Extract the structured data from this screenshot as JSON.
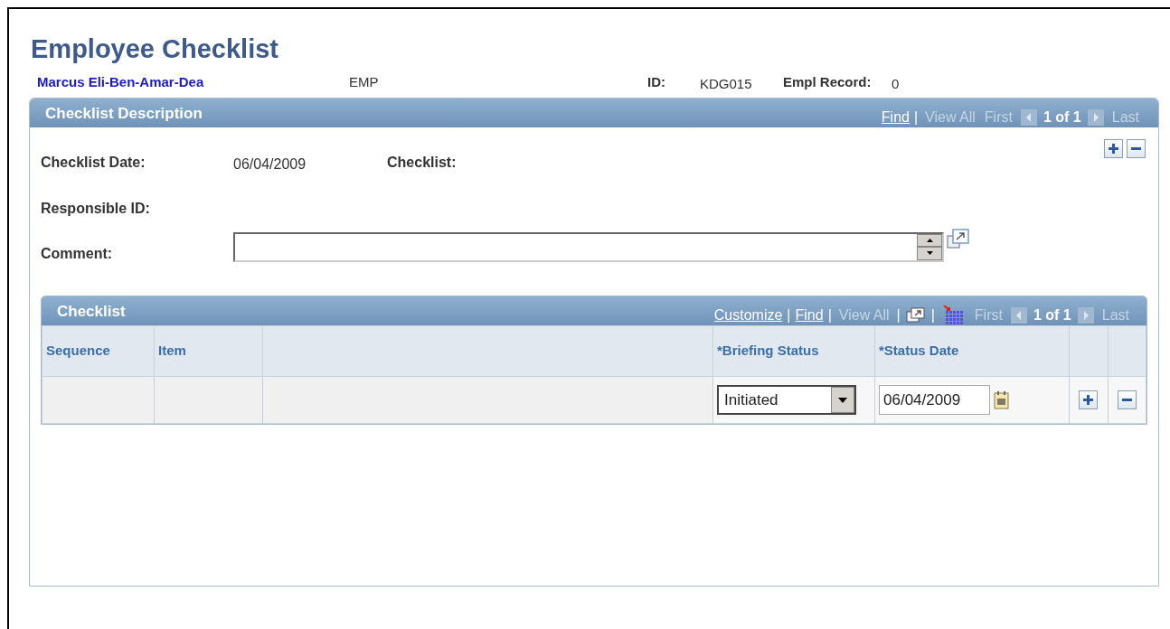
{
  "page_title": "Employee Checklist",
  "employee": {
    "name": "Marcus Eli-Ben-Amar-Dea",
    "type": "EMP",
    "id_label": "ID:",
    "id": "KDG015",
    "record_label": "Empl Record:",
    "record": "0"
  },
  "description_section": {
    "title": "Checklist Description",
    "nav": [
      {
        "kind": "link",
        "text": "Find"
      },
      {
        "kind": "separator",
        "text": "|"
      },
      {
        "kind": "disabled",
        "text": "View All"
      },
      {
        "kind": "disabled",
        "text": "First"
      },
      {
        "kind": "prev"
      },
      {
        "kind": "counter",
        "text": "1 of 1"
      },
      {
        "kind": "next"
      },
      {
        "kind": "disabled",
        "text": "Last"
      }
    ],
    "fields": [
      {
        "label": "Checklist Date:",
        "value": "06/04/2009"
      },
      {
        "label": "Checklist:"
      },
      {
        "label": "Responsible ID:"
      },
      {
        "label": "Comment:",
        "kind": "textarea"
      }
    ]
  },
  "checklist_grid": {
    "title": "Checklist",
    "nav": [
      {
        "kind": "link",
        "text": "Customize"
      },
      {
        "kind": "separator",
        "text": "|"
      },
      {
        "kind": "link",
        "text": "Find"
      },
      {
        "kind": "separator",
        "text": "|"
      },
      {
        "kind": "disabled",
        "text": "View All"
      },
      {
        "kind": "separator",
        "text": "|"
      },
      {
        "kind": "popup"
      },
      {
        "kind": "separator",
        "text": "|"
      },
      {
        "kind": "grid"
      },
      {
        "kind": "disabled",
        "text": "First"
      },
      {
        "kind": "prev"
      },
      {
        "kind": "counter",
        "text": "1 of 1"
      },
      {
        "kind": "next"
      },
      {
        "kind": "disabled",
        "text": "Last"
      }
    ],
    "columns": [
      "Sequence",
      "Item",
      "",
      "*Briefing Status",
      "*Status Date"
    ],
    "rows": [
      {
        "briefing_status": "Initiated",
        "status_date": "06/04/2009"
      }
    ]
  }
}
